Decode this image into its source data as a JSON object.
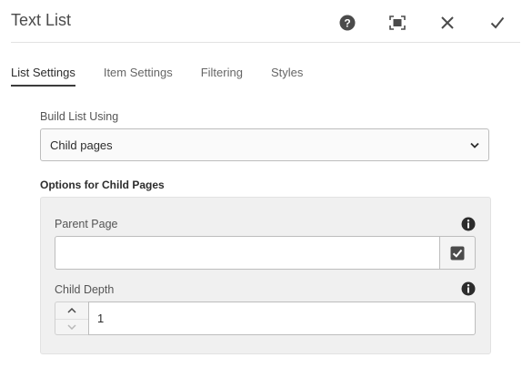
{
  "dialog": {
    "title": "Text List",
    "header_icons": [
      "help-icon",
      "fullscreen-icon",
      "close-icon",
      "checkmark-icon"
    ]
  },
  "tabs": [
    {
      "label": "List Settings",
      "active": true
    },
    {
      "label": "Item Settings",
      "active": false
    },
    {
      "label": "Filtering",
      "active": false
    },
    {
      "label": "Styles",
      "active": false
    }
  ],
  "build_list": {
    "label": "Build List Using",
    "value": "Child pages"
  },
  "child_options": {
    "heading": "Options for Child Pages",
    "parent_page": {
      "label": "Parent Page",
      "value": ""
    },
    "child_depth": {
      "label": "Child Depth",
      "value": "1"
    }
  }
}
